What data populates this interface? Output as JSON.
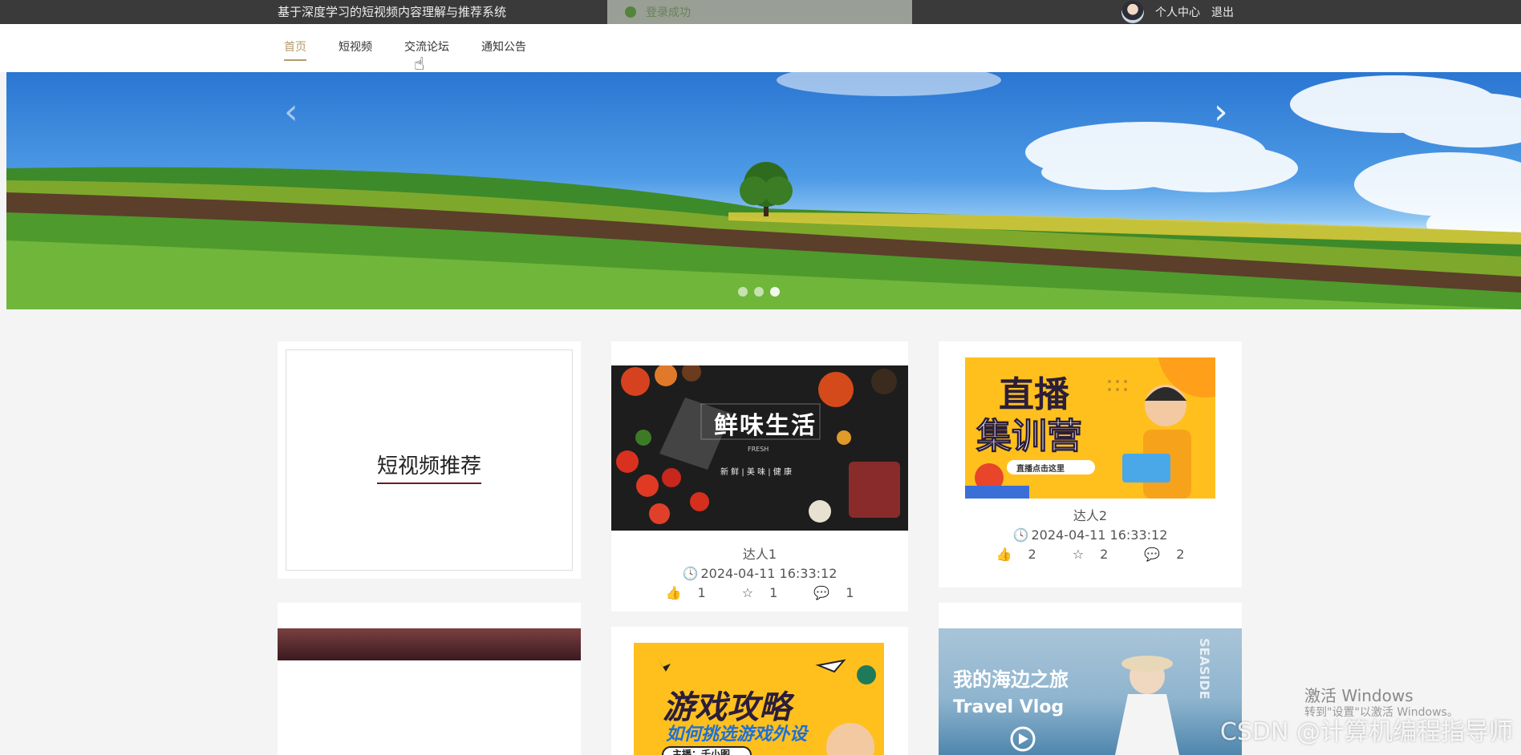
{
  "header": {
    "site_title": "基于深度学习的短视频内容理解与推荐系统",
    "toast": "登录成功",
    "personal_center": "个人中心",
    "logout": "退出"
  },
  "nav": {
    "items": [
      {
        "label": "首页",
        "active": true
      },
      {
        "label": "短视频"
      },
      {
        "label": "交流论坛"
      },
      {
        "label": "通知公告"
      }
    ]
  },
  "banner": {
    "prev": "‹",
    "next": "›",
    "dots": 3,
    "active_dot": 2
  },
  "recommend": {
    "title": "短视频推荐"
  },
  "cards": [
    {
      "image_text": "鲜味生活",
      "image_sub": "FRESH",
      "image_sub2": "新 鲜 | 美 味 | 健 康",
      "author": "达人1",
      "time": "2024-04-11 16:33:12",
      "likes": "1",
      "favorites": "1",
      "comments": "1"
    },
    {
      "image_text": "直播",
      "image_text2": "集训营",
      "image_sub": "直播点击这里",
      "author": "达人2",
      "time": "2024-04-11 16:33:12",
      "likes": "2",
      "favorites": "2",
      "comments": "2"
    },
    {
      "image_text": "游戏攻略",
      "image_sub": "如何挑选游戏外设",
      "image_sub2": "主播：千小图"
    },
    {
      "image_text": "我的海边之旅",
      "image_sub": "Travel Vlog",
      "image_side": "SEASIDE"
    }
  ],
  "watermarks": {
    "csdn": "CSDN @计算机编程指导师",
    "win1": "激活 Windows",
    "win2": "转到\"设置\"以激活 Windows。"
  },
  "colors": {
    "accent": "#b49a6a",
    "topbar": "#3a3a3a"
  }
}
